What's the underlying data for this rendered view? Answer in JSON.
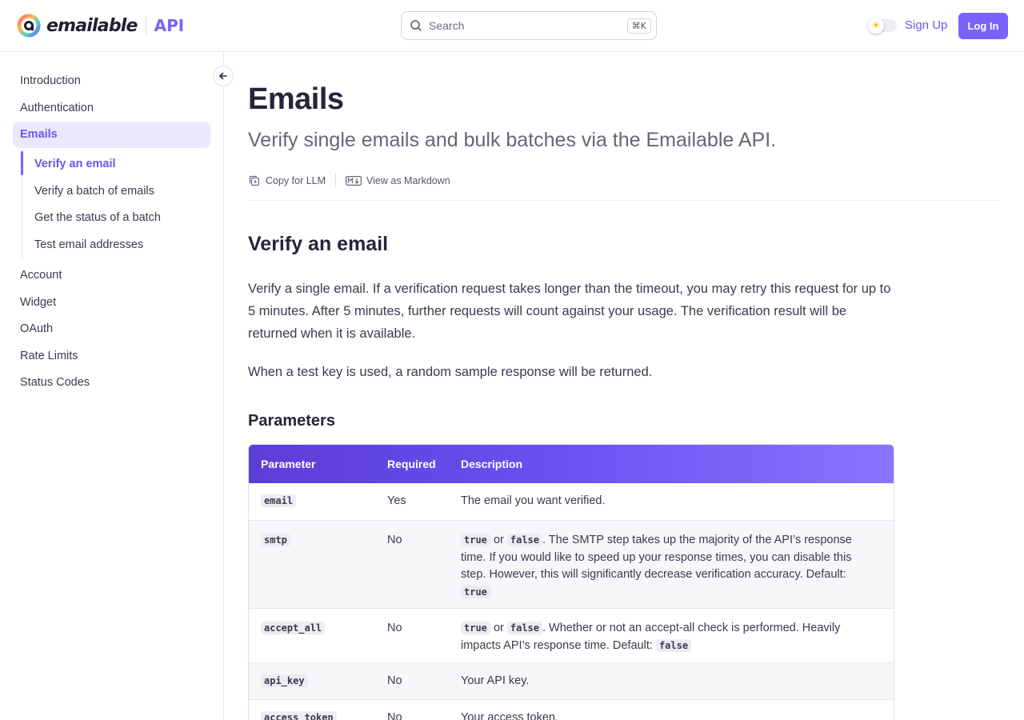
{
  "header": {
    "brand": "emailable",
    "product": "API",
    "search_placeholder": "Search",
    "search_shortcut": "⌘K",
    "signup_label": "Sign Up",
    "login_label": "Log In",
    "theme_icon": "sun-icon"
  },
  "sidebar": {
    "items_top": [
      "Introduction",
      "Authentication"
    ],
    "active_section": "Emails",
    "sub_items": [
      "Verify an email",
      "Verify a batch of emails",
      "Get the status of a batch",
      "Test email addresses"
    ],
    "items_bottom": [
      "Account",
      "Widget",
      "OAuth",
      "Rate Limits",
      "Status Codes"
    ]
  },
  "main": {
    "title": "Emails",
    "subtitle": "Verify single emails and bulk batches via the Emailable API.",
    "copy_llm_label": "Copy for LLM",
    "markdown_label": "View as Markdown",
    "section_title": "Verify an email",
    "para1": "Verify a single email. If a verification request takes longer than the timeout, you may retry this request for up to 5 minutes. After 5 minutes, further requests will count against your usage. The verification result will be returned when it is available.",
    "para2": "When a test key is used, a random sample response will be returned.",
    "params_title": "Parameters",
    "table": {
      "headers": [
        "Parameter",
        "Required",
        "Description"
      ],
      "rows": [
        {
          "param": "email",
          "required": "Yes",
          "desc": "The email you want verified."
        },
        {
          "param": "smtp",
          "required": "No",
          "code1": "true",
          "or": "or",
          "code2": "false",
          "desc": ". The SMTP step takes up the majority of the API’s response time. If you would like to speed up your response times, you can disable this step. However, this will significantly decrease verification accuracy. Default: ",
          "default": "true"
        },
        {
          "param": "accept_all",
          "required": "No",
          "code1": "true",
          "or": "or",
          "code2": "false",
          "desc": ". Whether or not an accept-all check is performed. Heavily impacts API’s response time. Default: ",
          "default": "false"
        },
        {
          "param": "api_key",
          "required": "No",
          "desc": "Your API key."
        },
        {
          "param": "access_token",
          "required": "No",
          "desc": "Your access token."
        }
      ]
    }
  },
  "colors": {
    "accent": "#7b61ff",
    "accent_text": "#6b57e8",
    "active_bg": "#ebe7fd"
  }
}
